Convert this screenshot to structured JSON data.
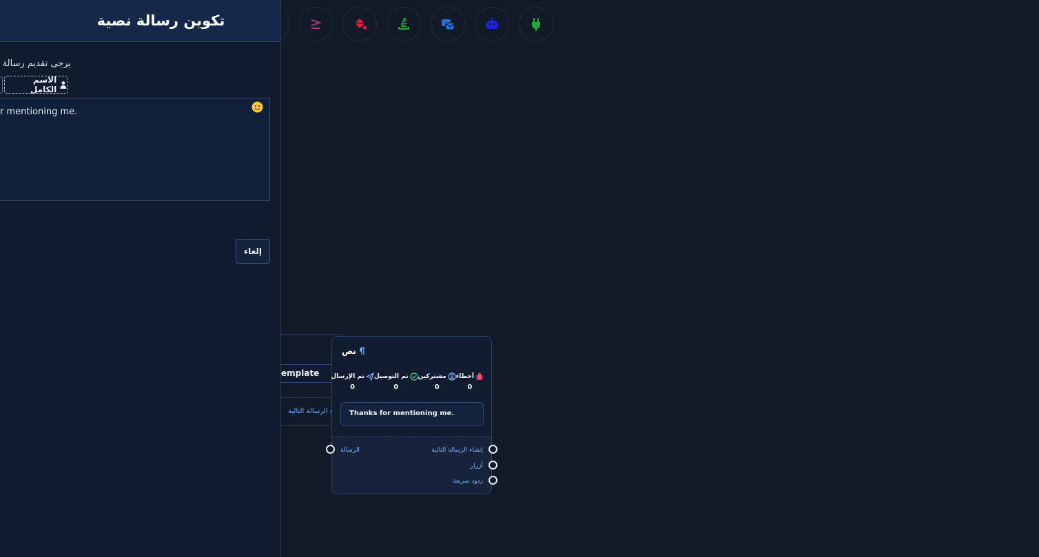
{
  "toolbar": {
    "tools": [
      {
        "name": "compare-icon",
        "color": "#9b3d7a"
      },
      {
        "name": "paint-bucket-icon",
        "color": "#e0204a"
      },
      {
        "name": "stack-icon",
        "color": "#22a83a"
      },
      {
        "name": "template-icon",
        "color": "#1f73e8"
      },
      {
        "name": "robot-icon",
        "color": "#1a22e0"
      },
      {
        "name": "plug-icon",
        "color": "#22a83a"
      }
    ]
  },
  "panel": {
    "title": "تكوين رسالة نصية",
    "prompt": "يرجى تقديم رسالة ا",
    "full_name_chip": "الاسم الكامل",
    "message_text": "r mentioning me.",
    "cancel_label": "إلغاء"
  },
  "back_node": {
    "field_value": "emplate",
    "next_label": "إنشاء الرسالة التالية"
  },
  "node": {
    "title": "نص",
    "stats": [
      {
        "label": "أخطاء",
        "value": "0",
        "icon": "bug-icon",
        "color": "#ff4d6d"
      },
      {
        "label": "مشتركين",
        "value": "0",
        "icon": "user-circle-icon",
        "color": "#7db2ff"
      },
      {
        "label": "تم التوصيل",
        "value": "0",
        "icon": "check-circle-icon",
        "color": "#3ddc84"
      },
      {
        "label": "تم الإرسال",
        "value": "0",
        "icon": "send-icon",
        "color": "#7db2ff"
      }
    ],
    "message_preview": "Thanks for mentioning me.",
    "input_port_label": "الرسالة",
    "outputs": [
      "إنشاء الرسالة التالية",
      "أزرار",
      "ردود سريعة"
    ]
  }
}
